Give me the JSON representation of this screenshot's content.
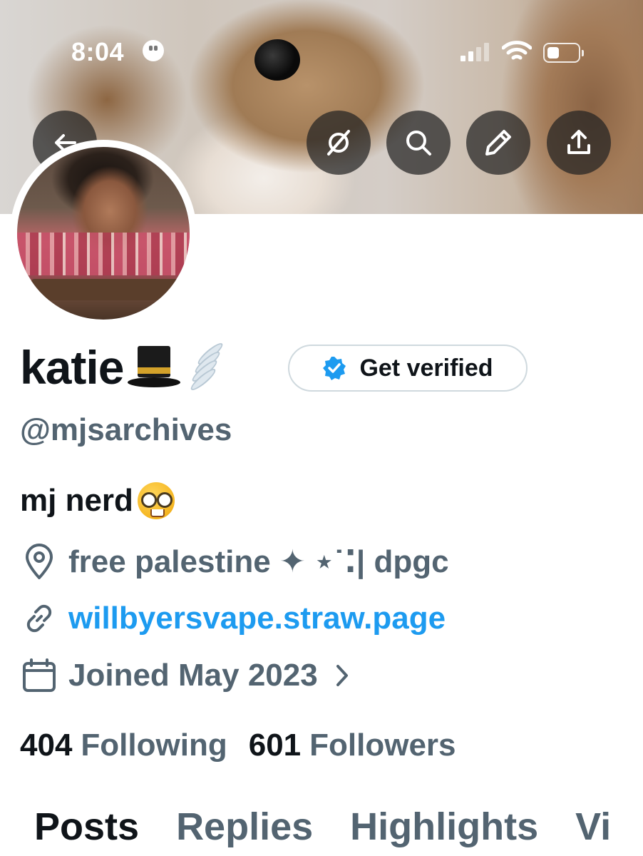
{
  "status_bar": {
    "time": "8:04"
  },
  "profile": {
    "display_name": "katie",
    "handle": "@mjsarchives",
    "bio": "mj nerd",
    "location": "free palestine ✦ ⋆˙⁚| dpgc",
    "website": "willbyersvape.straw.page",
    "joined": "Joined May 2023"
  },
  "verify_button": {
    "label": "Get verified"
  },
  "stats": {
    "following_count": "404",
    "following_label": "Following",
    "followers_count": "601",
    "followers_label": "Followers"
  },
  "tabs": [
    {
      "label": "Posts",
      "active": true
    },
    {
      "label": "Replies"
    },
    {
      "label": "Highlights"
    },
    {
      "label": "Vi"
    }
  ],
  "icons": {
    "back": "arrow-left-icon",
    "spaces": "circle-slash-icon",
    "search": "search-icon",
    "edit": "pencil-icon",
    "share": "share-icon",
    "location": "map-pin-icon",
    "link": "link-icon",
    "calendar": "calendar-icon",
    "verified": "verified-badge-icon"
  },
  "colors": {
    "accent": "#1d9bf0",
    "secondary_text": "#536471",
    "primary_text": "#0f1419"
  }
}
